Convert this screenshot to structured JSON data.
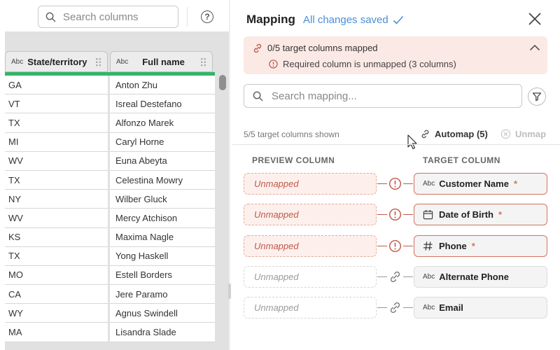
{
  "left_panel": {
    "search_placeholder": "Search columns",
    "help_label": "?",
    "columns": [
      {
        "type_label": "Abc",
        "name": "State/territory"
      },
      {
        "type_label": "Abc",
        "name": "Full name"
      }
    ],
    "rows": [
      [
        "GA",
        "Anton Zhu"
      ],
      [
        "VT",
        "Isreal Destefano"
      ],
      [
        "TX",
        "Alfonzo Marek"
      ],
      [
        "MI",
        "Caryl Horne"
      ],
      [
        "WV",
        "Euna Abeyta"
      ],
      [
        "TX",
        "Celestina Mowry"
      ],
      [
        "NY",
        "Wilber Gluck"
      ],
      [
        "WV",
        "Mercy Atchison"
      ],
      [
        "KS",
        "Maxima Nagle"
      ],
      [
        "TX",
        "Yong Haskell"
      ],
      [
        "MO",
        "Estell Borders"
      ],
      [
        "CA",
        "Jere Paramo"
      ],
      [
        "WY",
        "Agnus Swindell"
      ],
      [
        "MA",
        "Lisandra Slade"
      ]
    ]
  },
  "mapping_panel": {
    "title": "Mapping",
    "saved_status": "All changes saved",
    "alert": {
      "summary": "0/5 target columns mapped",
      "detail": "Required column is unmapped (3 columns)"
    },
    "search_placeholder": "Search mapping...",
    "shown_text": "5/5 target columns shown",
    "automap_label": "Automap (5)",
    "unmap_label": "Unmap",
    "preview_header": "PREVIEW COLUMN",
    "target_header": "TARGET COLUMN",
    "mappings": [
      {
        "preview": "Unmapped",
        "target": "Customer Name",
        "required_mark": "*",
        "type_icon": "abc-text-icon",
        "type_label": "Abc",
        "status": "warning"
      },
      {
        "preview": "Unmapped",
        "target": "Date of Birth",
        "required_mark": "*",
        "type_icon": "calendar-icon",
        "type_label": "",
        "status": "warning"
      },
      {
        "preview": "Unmapped",
        "target": "Phone",
        "required_mark": "*",
        "type_icon": "hash-icon",
        "type_label": "",
        "status": "warning"
      },
      {
        "preview": "Unmapped",
        "target": "Alternate Phone",
        "required_mark": "",
        "type_icon": "abc-text-icon",
        "type_label": "Abc",
        "status": "ok"
      },
      {
        "preview": "Unmapped",
        "target": "Email",
        "required_mark": "",
        "type_icon": "abc-text-icon",
        "type_label": "Abc",
        "status": "ok"
      }
    ]
  },
  "colors": {
    "accent_blue": "#4a8fd6",
    "warning": "#c0574a",
    "alert_bg": "#fbe9e5",
    "mapped_green": "#35b56a"
  }
}
